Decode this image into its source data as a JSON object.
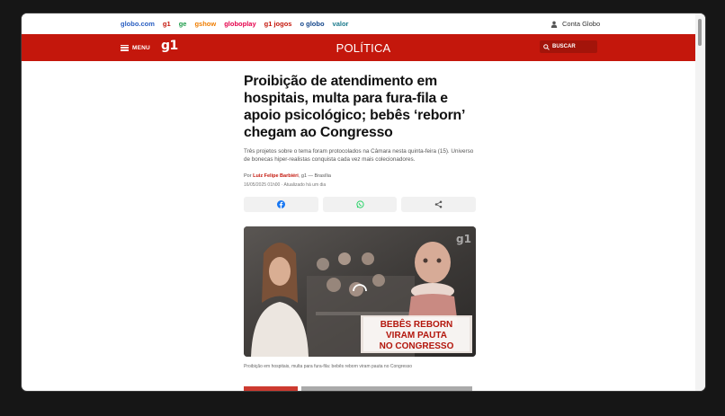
{
  "globo_links": [
    {
      "label": "globo.com",
      "color": "#2a5fc2"
    },
    {
      "label": "g1",
      "color": "#c4170c"
    },
    {
      "label": "ge",
      "color": "#1e9c4a"
    },
    {
      "label": "gshow",
      "color": "#ef7d00"
    },
    {
      "label": "globoplay",
      "color": "#e5004b"
    },
    {
      "label": "g1 jogos",
      "color": "#c4170c"
    },
    {
      "label": "o globo",
      "color": "#13458a"
    },
    {
      "label": "valor",
      "color": "#1a7a8c"
    }
  ],
  "account": {
    "label": "Conta Globo",
    "icon": "user-icon"
  },
  "header": {
    "menu_label": "MENU",
    "logo": "g1",
    "section": "POLÍTICA",
    "search_label": "BUSCAR",
    "accent": "#c4170c"
  },
  "article": {
    "title": "Proibição de atendimento em hospitais, multa para fura-fila e apoio psicológico; bebês ‘reborn’ chegam ao Congresso",
    "subtitle": "Três projetos sobre o tema foram protocolados na Câmara nesta quinta-feira (15). Universo de bonecas hiper-realistas conquista cada vez mais colecionadores.",
    "byline_prefix": "Por ",
    "author": "Luiz Felipe Barbiéri",
    "byline_suffix": ", g1 — Brasília",
    "date": "16/05/2025 01h00 · Atualizado há um dia",
    "share": [
      "facebook-icon",
      "whatsapp-icon",
      "share-icon"
    ],
    "video": {
      "watermark": "g1",
      "banner_line1": "BEBÊS REBORN",
      "banner_line2": "VIRAM PAUTA",
      "banner_line3": "NO CONGRESSO"
    },
    "caption": "Proibição em hospitais, multa para fura-fila: bebês reborn viram pauta no Congresso"
  }
}
